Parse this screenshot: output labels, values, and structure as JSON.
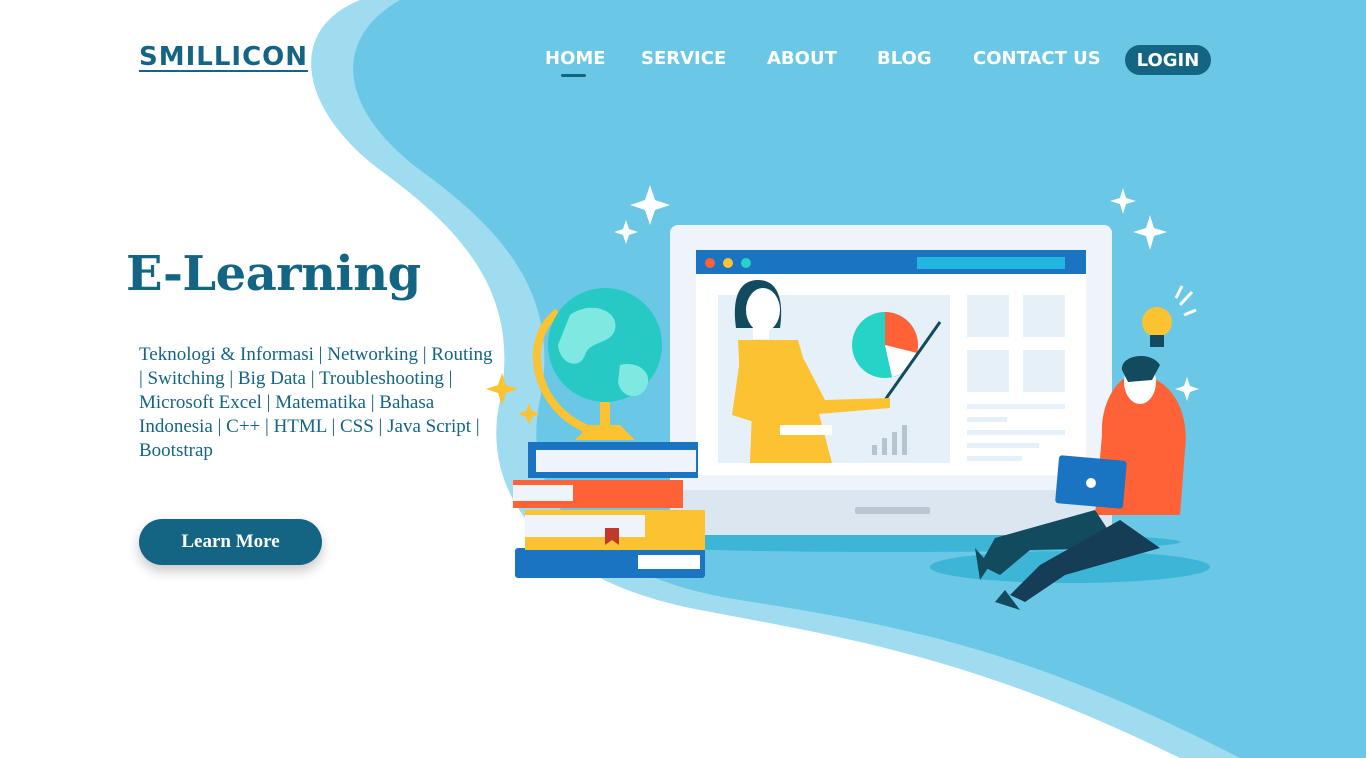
{
  "brand": {
    "name": "SMILLICON"
  },
  "nav": {
    "items": [
      {
        "label": "HOME",
        "active": true
      },
      {
        "label": "SERVICE",
        "active": false
      },
      {
        "label": "ABOUT",
        "active": false
      },
      {
        "label": "BLOG",
        "active": false
      },
      {
        "label": "CONTACT US",
        "active": false
      }
    ],
    "login_label": "LOGIN"
  },
  "hero": {
    "title": "E-Learning",
    "topics_text": "Teknologi & Informasi | Networking | Routing | Switching | Big Data | Troubleshooting | Microsoft Excel | Matematika | Bahasa Indonesia | C++ | HTML | CSS | Java Script | Bootstrap",
    "cta_label": "Learn More"
  },
  "illustration": {
    "icons": [
      "globe-icon",
      "books-icon",
      "laptop-screen-icon",
      "teacher-icon",
      "pie-chart-icon",
      "bar-chart-icon",
      "student-icon",
      "lightbulb-icon",
      "sparkle-icon"
    ]
  },
  "colors": {
    "brand_dark": "#136583",
    "sky_blue": "#6ac7e6",
    "light_blue": "#9fdcef",
    "accent_orange": "#ff6236",
    "accent_yellow": "#fbc232",
    "accent_teal": "#26d4c7"
  }
}
